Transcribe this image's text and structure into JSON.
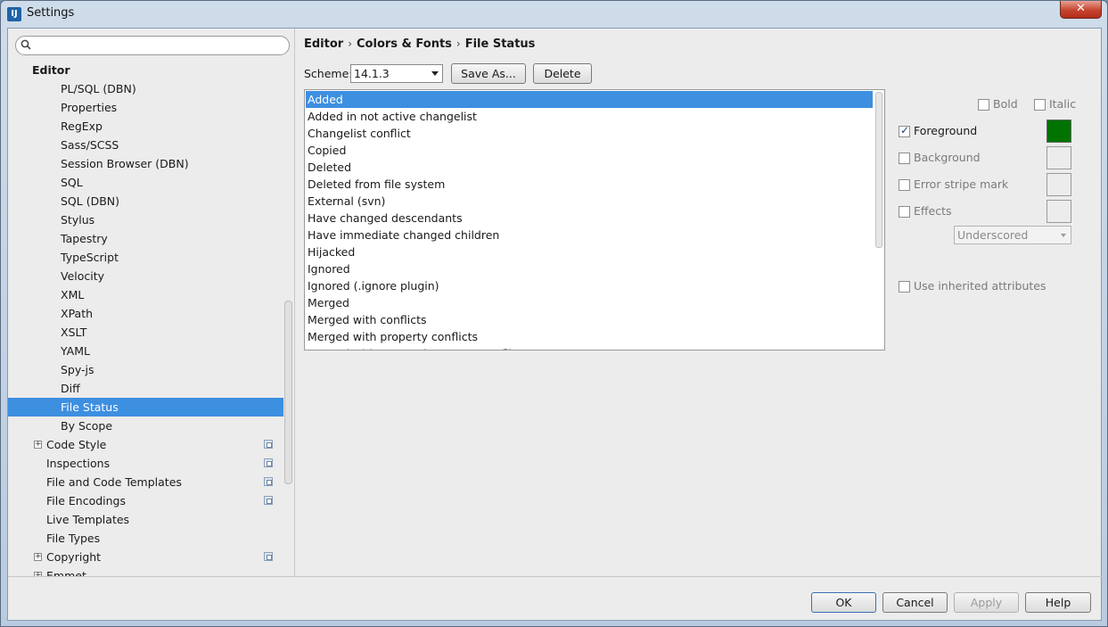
{
  "window": {
    "title": "Settings",
    "close_glyph": "✕"
  },
  "search": {
    "value": "",
    "placeholder": ""
  },
  "tree": {
    "section": "Editor",
    "items": [
      {
        "label": "PL/SQL (DBN)"
      },
      {
        "label": "Properties"
      },
      {
        "label": "RegExp"
      },
      {
        "label": "Sass/SCSS"
      },
      {
        "label": "Session Browser (DBN)"
      },
      {
        "label": "SQL"
      },
      {
        "label": "SQL (DBN)"
      },
      {
        "label": "Stylus"
      },
      {
        "label": "Tapestry"
      },
      {
        "label": "TypeScript"
      },
      {
        "label": "Velocity"
      },
      {
        "label": "XML"
      },
      {
        "label": "XPath"
      },
      {
        "label": "XSLT"
      },
      {
        "label": "YAML"
      },
      {
        "label": "Spy-js"
      },
      {
        "label": "Diff"
      },
      {
        "label": "File Status"
      },
      {
        "label": "By Scope"
      }
    ],
    "selected": "File Status",
    "subitems": [
      {
        "label": "Code Style"
      },
      {
        "label": "Inspections"
      },
      {
        "label": "File and Code Templates"
      },
      {
        "label": "File Encodings"
      },
      {
        "label": "Live Templates"
      },
      {
        "label": "File Types"
      },
      {
        "label": "Copyright"
      },
      {
        "label": "Emmet"
      }
    ]
  },
  "breadcrumb": [
    "Editor",
    "Colors & Fonts",
    "File Status"
  ],
  "breadcrumb_sep": "›",
  "scheme": {
    "label": "Scheme:",
    "value": "14.1.3",
    "save_as": "Save As...",
    "delete": "Delete"
  },
  "status_list": [
    "Added",
    "Added in not active changelist",
    "Changelist conflict",
    "Copied",
    "Deleted",
    "Deleted from file system",
    "External (svn)",
    "Have changed descendants",
    "Have immediate changed children",
    "Hijacked",
    "Ignored",
    "Ignored (.ignore plugin)",
    "Merged",
    "Merged with conflicts",
    "Merged with property conflicts",
    "Merged with text and property conflicts"
  ],
  "attributes": {
    "bold": "Bold",
    "italic": "Italic",
    "foreground": "Foreground",
    "background": "Background",
    "error_stripe": "Error stripe mark",
    "effects": "Effects",
    "effect_type": "Underscored",
    "use_inherited": "Use inherited attributes",
    "foreground_color": "#007300",
    "check_glyph": "✓"
  },
  "footer": {
    "ok": "OK",
    "cancel": "Cancel",
    "apply": "Apply",
    "help": "Help"
  },
  "colors": {
    "selection": "#3d8fe0",
    "panel": "#ececec"
  }
}
